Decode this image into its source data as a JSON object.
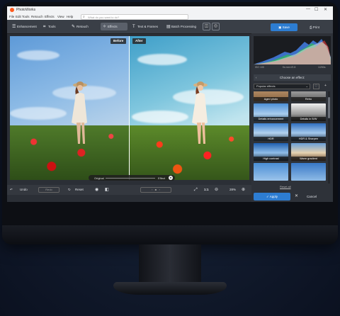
{
  "app": {
    "title": "PhotoWorks"
  },
  "window_controls": {
    "minimize": "—",
    "maximize": "☐",
    "close": "✕"
  },
  "menu": [
    "File",
    "Edit",
    "Tools",
    "Retouch",
    "Effects",
    "View",
    "Help"
  ],
  "search": {
    "placeholder": "What do you want to do?"
  },
  "toolbar": {
    "tabs": [
      {
        "label": "Enhancement",
        "icon": "sliders-icon"
      },
      {
        "label": "Tools",
        "icon": "crop-icon"
      },
      {
        "label": "Retouch",
        "icon": "brush-icon"
      },
      {
        "label": "Effects",
        "icon": "magic-wand-icon",
        "active": true
      },
      {
        "label": "Text & Frames",
        "icon": "text-icon"
      },
      {
        "label": "Batch Processing",
        "icon": "batch-icon"
      }
    ],
    "save_label": "Save",
    "print_label": "Print"
  },
  "preview": {
    "before_label": "Before",
    "after_label": "After",
    "compare": {
      "left": "Original",
      "right": "Effect"
    }
  },
  "bottom": {
    "undo": "Undo",
    "redo": "Redo",
    "reset": "Reset",
    "zoom_ratio": "1:1",
    "zoom_percent": "28%"
  },
  "histogram": {
    "left_label": "ISO 100",
    "mid_label": "f/s mm f/2.8",
    "right_label": "1/250s"
  },
  "effects_panel": {
    "title": "Choose an effect:",
    "category": "Popular effects",
    "effects": [
      {
        "label": "Aged photo",
        "style": "sepia"
      },
      {
        "label": "Retro",
        "style": "mono"
      },
      {
        "label": "Details enhancement",
        "style": "sky"
      },
      {
        "label": "Details in B/W",
        "style": "bw"
      },
      {
        "label": "HDR",
        "style": "sky"
      },
      {
        "label": "HDR & Sharpen",
        "style": "skyb"
      },
      {
        "label": "High contrast",
        "style": "deep"
      },
      {
        "label": "Warm gradient",
        "style": "warm"
      },
      {
        "label": "",
        "style": "sky"
      },
      {
        "label": "",
        "style": "skyb"
      }
    ],
    "reset_all": "Reset all",
    "apply": "Apply",
    "cancel": "Cancel"
  },
  "colors": {
    "accent": "#2d7dd2",
    "toolbar": "#3a3f47",
    "panel": "#2e3239"
  }
}
